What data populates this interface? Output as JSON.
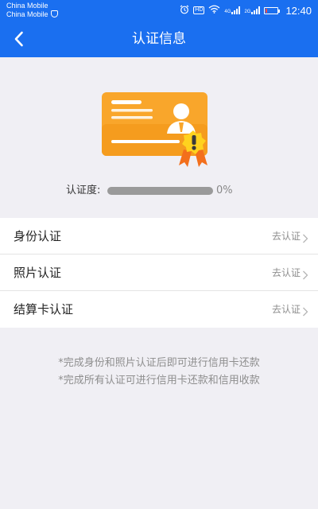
{
  "status_bar": {
    "carrier_1": "China Mobile",
    "carrier_2": "China Mobile",
    "hd_badge": "HD",
    "network_1": "4G",
    "network_2": "2G",
    "time": "12:40",
    "battery_level": 0.15,
    "icons": [
      "alarm-icon",
      "wifi-icon",
      "signal-icon",
      "battery-icon"
    ]
  },
  "nav": {
    "title": "认证信息",
    "back_icon": "chevron-left-icon"
  },
  "verification": {
    "label": "认证度:",
    "percent_text": "0%",
    "progress": 0
  },
  "items": [
    {
      "label": "身份认证",
      "action": "去认证"
    },
    {
      "label": "照片认证",
      "action": "去认证"
    },
    {
      "label": "结算卡认证",
      "action": "去认证"
    }
  ],
  "notes": [
    "*完成身份和照片认证后即可进行信用卡还款",
    "*完成所有认证可进行信用卡还款和信用收款"
  ],
  "colors": {
    "primary": "#1a6ff0",
    "card": "#f9a62b",
    "badge": "#ffd21e",
    "ribbon": "#f36f1c"
  }
}
